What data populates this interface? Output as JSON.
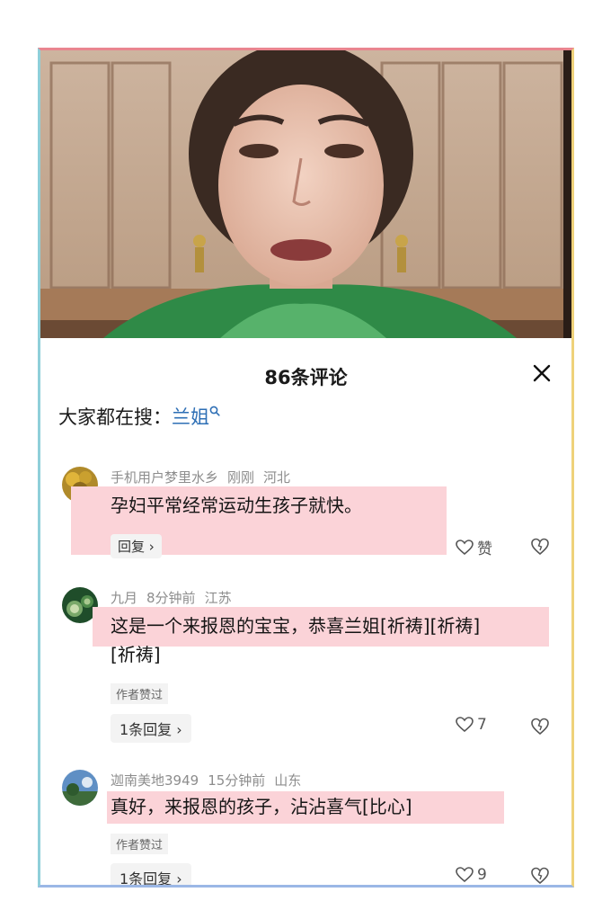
{
  "panel": {
    "title": "86条评论",
    "search_label": "大家都在搜：",
    "search_keyword": "兰姐"
  },
  "comments": [
    {
      "user": "手机用户梦里水乡",
      "time": "刚刚",
      "location": "河北",
      "text": "孕妇平常经常运动生孩子就快。",
      "reply_label": "回复 ›",
      "like_label": "赞"
    },
    {
      "user": "九月",
      "time": "8分钟前",
      "location": "江苏",
      "text_line1": "这是一个来报恩的宝宝，恭喜兰姐[祈祷][祈祷]",
      "text_line2": "[祈祷]",
      "author_liked": "作者赞过",
      "reply_label": "1条回复 ›",
      "like_count": "7"
    },
    {
      "user": "迦南美地3949",
      "time": "15分钟前",
      "location": "山东",
      "text": "真好，来报恩的孩子，沾沾喜气[比心]",
      "author_liked": "作者赞过",
      "reply_label": "1条回复 ›",
      "like_count": "9"
    }
  ],
  "colors": {
    "highlight": "#fbd3d8",
    "keyword": "#2e6fb5",
    "meta_text": "#8d8d8d"
  },
  "icons": [
    "close-icon",
    "search-icon",
    "heart-icon",
    "dislike-heart-icon"
  ]
}
